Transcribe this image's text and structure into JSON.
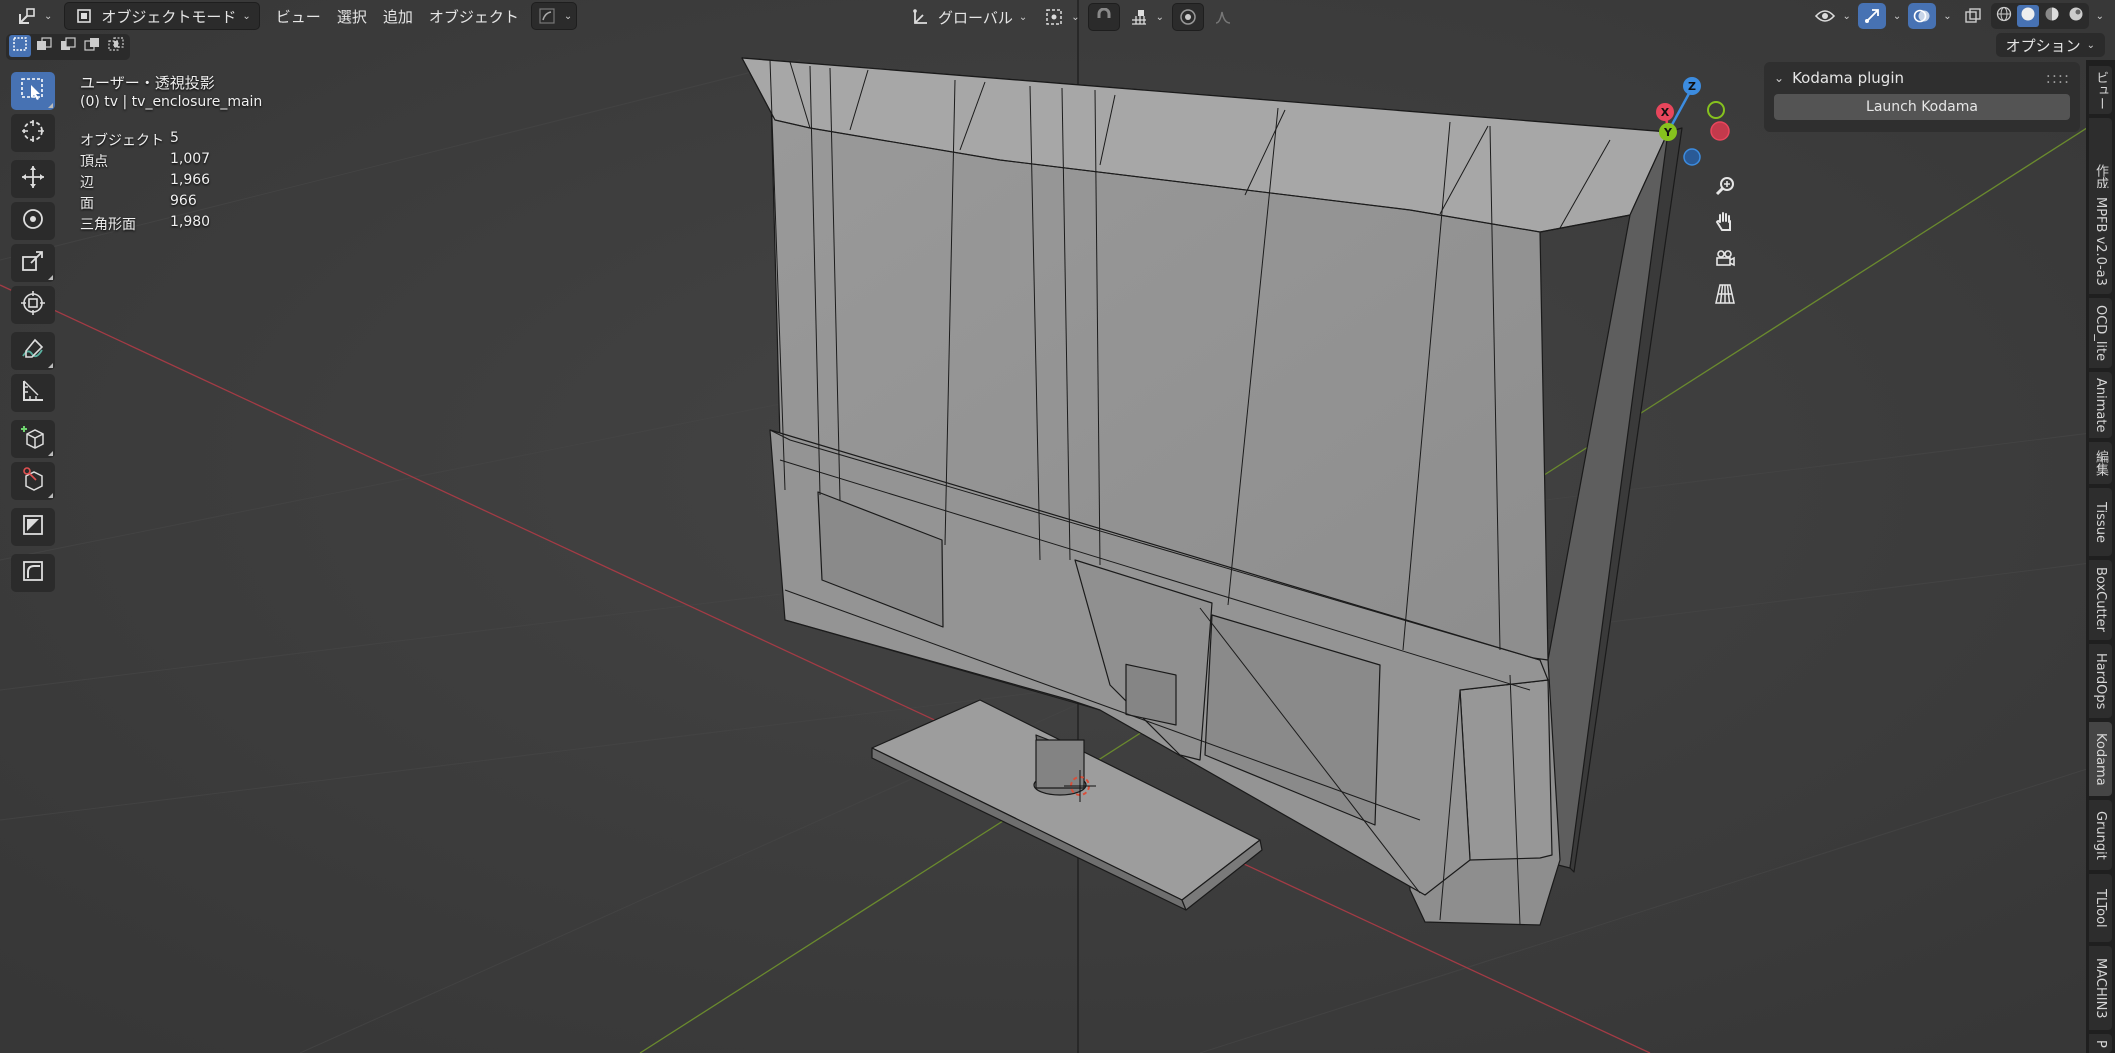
{
  "header": {
    "mode_label": "オブジェクトモード",
    "menus": [
      "ビュー",
      "選択",
      "追加",
      "オブジェクト"
    ],
    "transform_orientation": "グローバル",
    "options_label": "オプション"
  },
  "overlay": {
    "view_name": "ユーザー・透視投影",
    "object_name": "(0) tv | tv_enclosure_main",
    "stats": [
      {
        "label": "オブジェクト",
        "value": "5"
      },
      {
        "label": "頂点",
        "value": "1,007"
      },
      {
        "label": "辺",
        "value": "1,966"
      },
      {
        "label": "面",
        "value": "966"
      },
      {
        "label": "三角形面",
        "value": "1,980"
      }
    ]
  },
  "gizmo": {
    "x": "X",
    "y": "Y",
    "z": "Z"
  },
  "panel": {
    "title": "Kodama plugin",
    "button": "Launch Kodama",
    "dots": "::::"
  },
  "tabs": [
    "ビュー",
    "作成",
    "MPFB v2.0-a3",
    "OCD_lite",
    "Animate",
    "編集",
    "Tissue",
    "BoxCutter",
    "HardOps",
    "Kodama",
    "Grungit",
    "TLTool",
    "MACHIN3",
    "P"
  ],
  "active_tab": "Kodama",
  "colors": {
    "viewport_bg": "#3d3d3d",
    "accent": "#4772b3",
    "axis_x": "#e8465c",
    "axis_y": "#86c21e",
    "axis_z": "#3c8ce0"
  }
}
